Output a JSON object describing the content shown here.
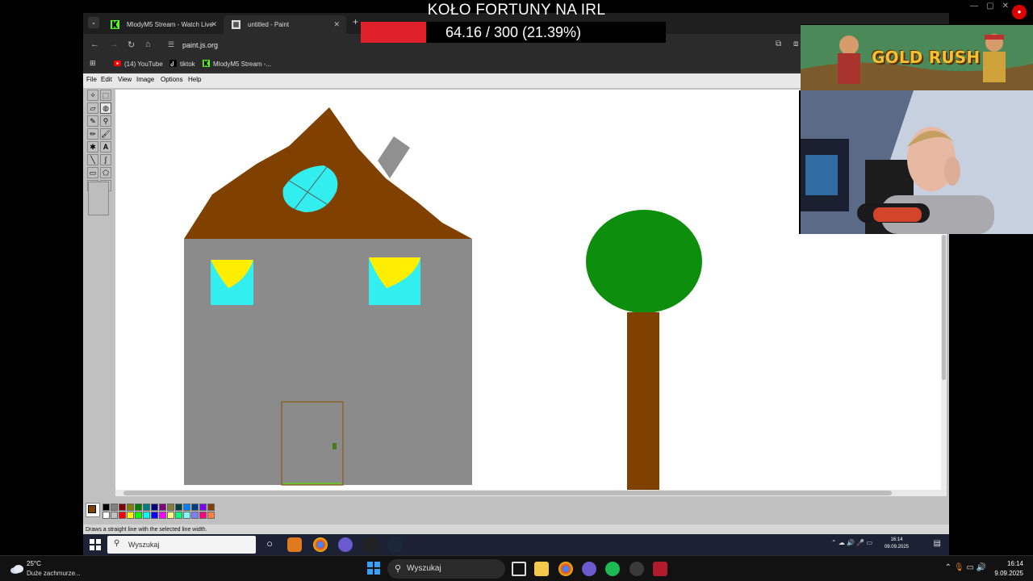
{
  "overlay": {
    "title": "KOŁO FORTUNY NA IRL",
    "progress_text": "64.16 / 300 (21.39%)",
    "progress_value": 64.16,
    "progress_max": 300,
    "progress_color": "#e0202a"
  },
  "browser": {
    "tabs": [
      {
        "label": "MlodyM5 Stream - Watch Live",
        "icon": "kick-icon",
        "active": false
      },
      {
        "label": "untitled - Paint",
        "icon": "paint-icon",
        "active": true
      }
    ],
    "url": "paint.js.org",
    "bookmarks": [
      {
        "label": "(14) YouTube",
        "icon": "youtube-icon"
      },
      {
        "label": "tiktok",
        "icon": "tiktok-icon"
      },
      {
        "label": "MlodyM5 Stream -...",
        "icon": "kick-icon"
      }
    ]
  },
  "paint": {
    "menu": [
      "File",
      "Edit",
      "View",
      "Image",
      "Options",
      "Help"
    ],
    "status": "Draws a straight line with the selected line width.",
    "foreground_color": "#804000",
    "palette": [
      "#000000",
      "#808080",
      "#800000",
      "#808000",
      "#008000",
      "#008080",
      "#000080",
      "#800080",
      "#808040",
      "#004040",
      "#0080ff",
      "#004080",
      "#8000ff",
      "#804000",
      "#ffffff",
      "#c0c0c0",
      "#ff0000",
      "#ffff00",
      "#00ff00",
      "#00ffff",
      "#0000ff",
      "#ff00ff",
      "#ffff80",
      "#00ff80",
      "#80ffff",
      "#8080ff",
      "#ff0080",
      "#ff8040"
    ],
    "drawing_colors": {
      "roof": "#804000",
      "wall": "#8b8b8b",
      "window": "#33eeee",
      "window_fill": "#ffee00",
      "chimney": "#909090",
      "tree_top": "#0d8f0d",
      "tree_trunk": "#804000"
    }
  },
  "inner_taskbar": {
    "search_placeholder": "Wyszukaj",
    "time": "16:14",
    "date": "09.09.2025"
  },
  "game": {
    "title": "GOLD RUSH"
  },
  "taskbar": {
    "weather_temp": "25°C",
    "weather_desc": "Duże zachmurze...",
    "search_placeholder": "Wyszukaj",
    "time": "16:14",
    "date": "9.09.2025"
  }
}
